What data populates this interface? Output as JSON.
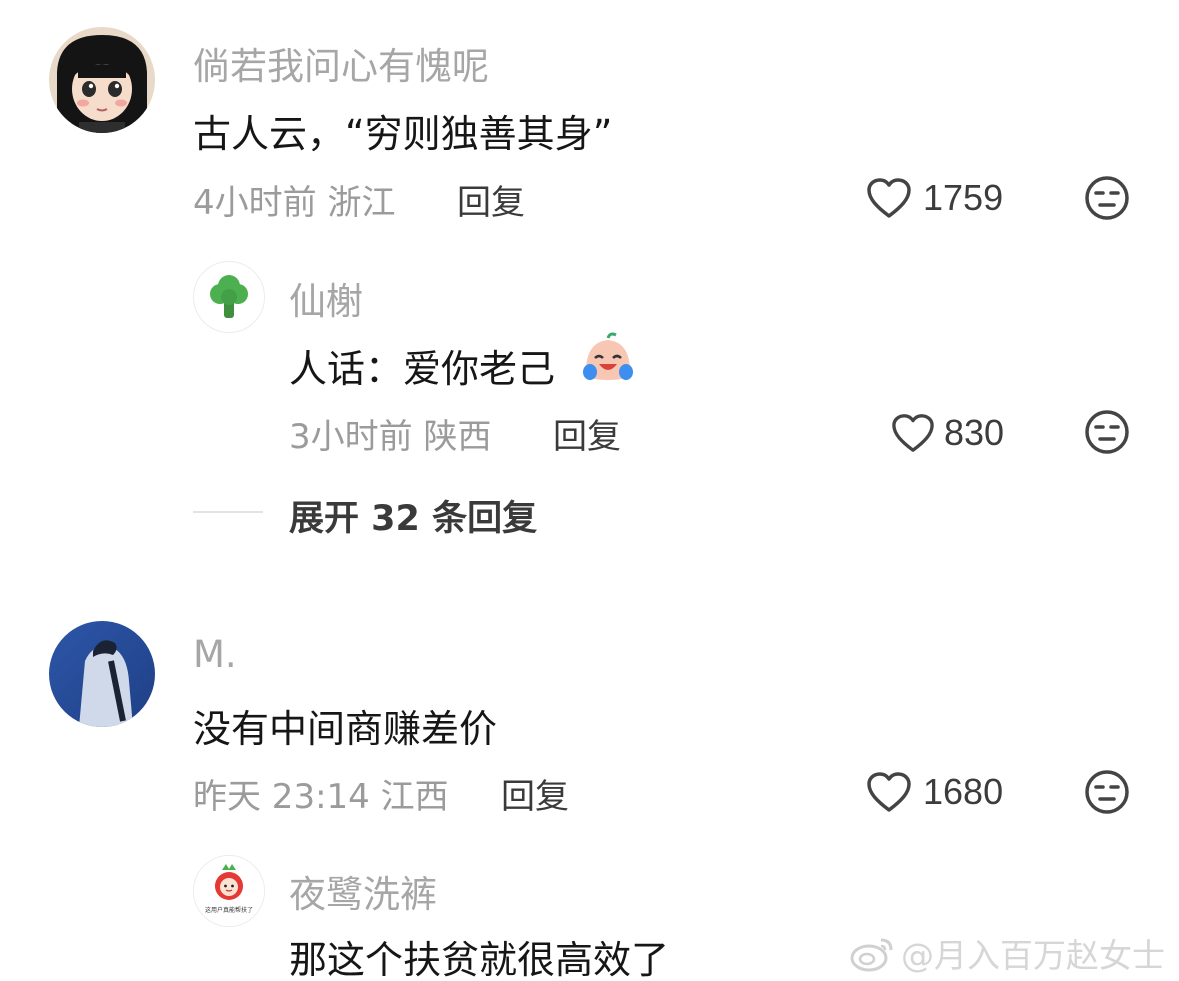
{
  "comments": [
    {
      "username": "倘若我问心有愧呢",
      "text": "古人云，“穷则独善其身”",
      "meta": "4小时前 浙江",
      "reply_label": "回复",
      "likes": "1759",
      "replies": [
        {
          "username": "仙榭",
          "text": "人话：爱你老己",
          "meta": "3小时前 陕西",
          "reply_label": "回复",
          "likes": "830"
        }
      ],
      "expand_label": "展开 32 条回复"
    },
    {
      "username": "M.",
      "text": "没有中间商赚差价",
      "meta": "昨天 23:14 江西",
      "reply_label": "回复",
      "likes": "1680",
      "replies": [
        {
          "username": "夜鹭洗裤",
          "text": "那这个扶贫就很高效了",
          "avatar_caption": "这用户真能帮扶了"
        }
      ]
    }
  ],
  "watermark": "@月入百万赵女士",
  "icons": {
    "like": "heart-outline-icon",
    "dislike": "unamused-face-icon",
    "emoji": "crying-laughing-emoji-icon",
    "watermark": "weibo-logo-icon"
  },
  "colors": {
    "username": "#a6a6a6",
    "text": "#161616",
    "meta": "#9b9b9b",
    "action": "#3a3a3a"
  }
}
